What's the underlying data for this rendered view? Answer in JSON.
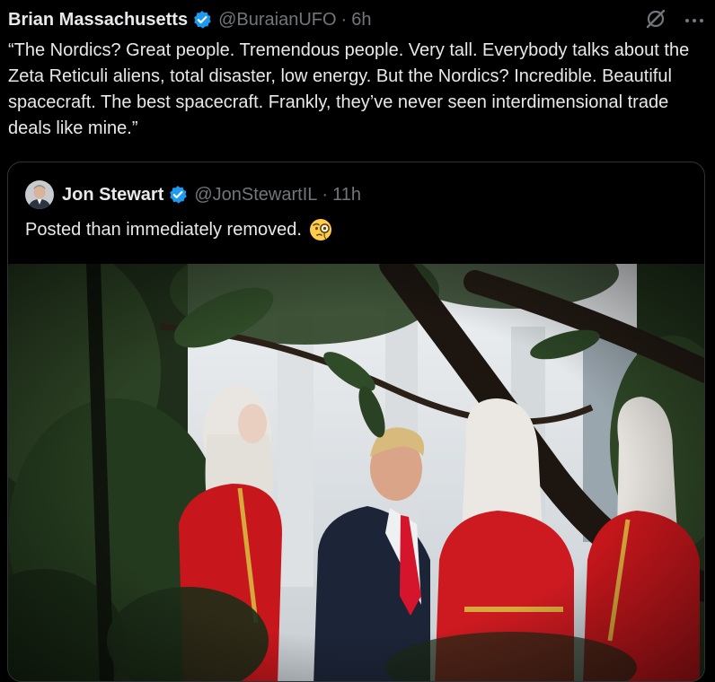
{
  "tweet": {
    "author_name": "Brian Massachusetts",
    "author_handle": "@BuraianUFO",
    "separator": "·",
    "time": "6h",
    "text": "“The Nordics? Great people. Tremendous people. Very tall. Everybody talks about the Zeta Reticuli aliens, total disaster, low energy. But the Nordics? Incredible. Beautiful spacecraft. The best spacecraft. Frankly, they’ve never seen interdimensional trade deals like mine.”",
    "icons": {
      "verified": "verified-badge-icon",
      "grok": "grok-icon",
      "more": "more-options-icon"
    }
  },
  "quote": {
    "author_name": "Jon Stewart",
    "author_handle": "@JonStewartIL",
    "separator": "·",
    "time": "11h",
    "text": "Posted than immediately removed.",
    "emoji": "face-with-monocle-emoji"
  },
  "colors": {
    "background": "#000000",
    "text_primary": "#e7e9ea",
    "text_secondary": "#71767b",
    "verified_blue": "#1d9bf0",
    "card_border": "#2f3336"
  }
}
